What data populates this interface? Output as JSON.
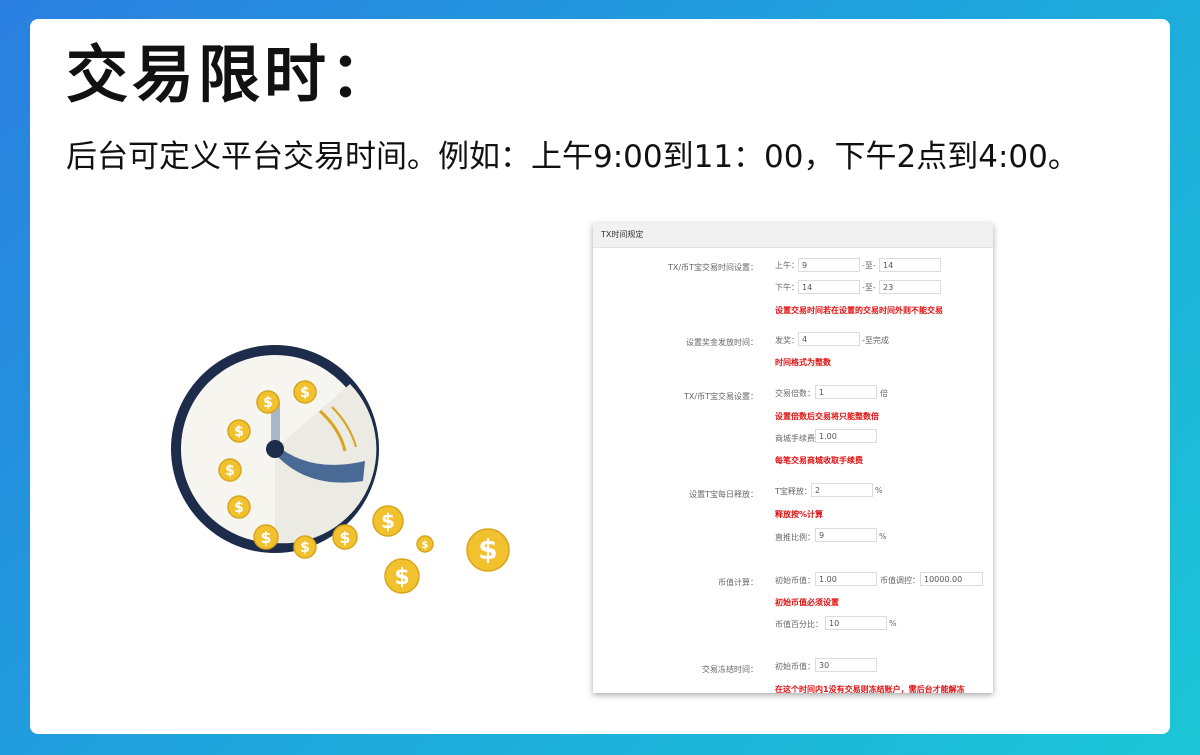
{
  "title": "交易限时：",
  "subtitle": "后台可定义平台交易时间。例如：上午9:00到11：00，下午2点到4:00。",
  "panel": {
    "header": "TX时间规定",
    "tx_time": {
      "label": "TX/币T宝交易时间设置：",
      "am_label": "上午：",
      "am_start": "9",
      "am_sep": "-至-",
      "am_end": "14",
      "pm_label": "下午：",
      "pm_start": "14",
      "pm_sep": "-至-",
      "pm_end": "23",
      "note": "设置交易时间若在设置的交易时间外则不能交易"
    },
    "reward": {
      "label": "设置奖金发放时间：",
      "send_label": "发奖：",
      "send_value": "4",
      "suffix": "-至完成",
      "note": "时间格式为整数"
    },
    "trade": {
      "label": "TX/币T宝交易设置：",
      "multiple_label": "交易倍数：",
      "multiple_value": "1",
      "multiple_unit": "倍",
      "multiple_note": "设置倍数后交易将只能整数倍",
      "fee_label": "商城手续费",
      "fee_value": "1.00",
      "fee_note": "每笔交易商城收取手续费"
    },
    "release": {
      "label": "设置T宝每日释放：",
      "release_label": "T宝释放：",
      "release_value": "2",
      "release_unit": "%",
      "release_note": "释放按%计算",
      "direct_label": "直推比例：",
      "direct_value": "9",
      "direct_unit": "%"
    },
    "coin": {
      "label": "币值计算：",
      "init_label": "初始币值：",
      "init_value": "1.00",
      "control_label": "币值调控：",
      "control_value": "10000.00",
      "init_note": "初始币值必须设置",
      "percent_label": "币值百分比：",
      "percent_value": "10",
      "percent_unit": "%"
    },
    "freeze": {
      "label": "交易冻结时间：",
      "init_label": "初始币值：",
      "init_value": "30",
      "note": "在这个时间内1没有交易则冻结账户，需后台才能解冻"
    }
  },
  "illustration": {
    "clock_color": "#1c2c4a",
    "hand_color": "#4a6a96",
    "coin_color": "#f2c12e",
    "coin_symbol": "$"
  }
}
